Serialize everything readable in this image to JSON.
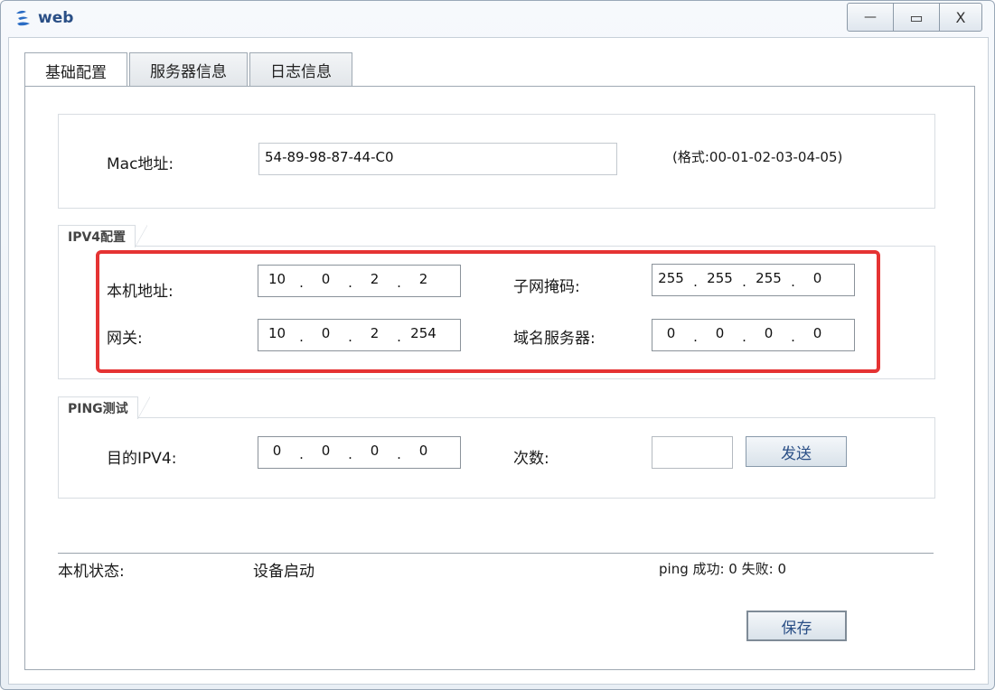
{
  "window": {
    "title": "web",
    "controls": {
      "minimize": "—",
      "maximize": "▭",
      "close": "X"
    }
  },
  "tabs": [
    {
      "label": "基础配置",
      "active": true
    },
    {
      "label": "服务器信息",
      "active": false
    },
    {
      "label": "日志信息",
      "active": false
    }
  ],
  "mac": {
    "label": "Mac地址:",
    "value": "54-89-98-87-44-C0",
    "hint": "(格式:00-01-02-03-04-05)"
  },
  "ipv4": {
    "group_title": "IPV4配置",
    "local_ip": {
      "label": "本机地址:",
      "octets": [
        "10",
        "0",
        "2",
        "2"
      ]
    },
    "subnet": {
      "label": "子网掩码:",
      "octets": [
        "255",
        "255",
        "255",
        "0"
      ]
    },
    "gateway": {
      "label": "网关:",
      "octets": [
        "10",
        "0",
        "2",
        "254"
      ]
    },
    "dns": {
      "label": "域名服务器:",
      "octets": [
        "0",
        "0",
        "0",
        "0"
      ]
    }
  },
  "ping": {
    "group_title": "PING测试",
    "target": {
      "label": "目的IPV4:",
      "octets": [
        "0",
        "0",
        "0",
        "0"
      ]
    },
    "count": {
      "label": "次数:",
      "value": ""
    },
    "send_label": "发送"
  },
  "status": {
    "label": "本机状态:",
    "value": "设备启动",
    "ping_result": "ping 成功: 0 失败: 0"
  },
  "save_label": "保存",
  "colors": {
    "highlight": "#e53333",
    "title": "#2a4f86"
  }
}
